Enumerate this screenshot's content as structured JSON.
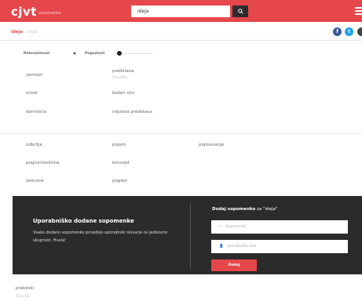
{
  "header": {
    "logo": "cjvt",
    "logo_sub": "sopomenke",
    "search_value": "ideja"
  },
  "subbar": {
    "word": "ideja",
    "extra": "[ideja]"
  },
  "controls": {
    "sort_label": "Relevantnost",
    "mode_label": "Pogostost",
    "slider_level": 0.1
  },
  "groups": [
    {
      "rows": [
        [
          {
            "text": "zamisel"
          },
          {
            "text": "predstava",
            "sub": "Prevedba"
          }
        ],
        [
          {
            "text": "misel"
          },
          {
            "text": "bežen vtis"
          }
        ],
        [
          {
            "text": "domislica"
          },
          {
            "text": "nejasna predstava"
          }
        ]
      ]
    },
    {
      "rows": [
        [
          {
            "text": "odkritje"
          },
          {
            "text": "pojem"
          },
          {
            "text": "pojmovanje"
          }
        ],
        [
          {
            "text": "pogruntavščina"
          },
          {
            "text": "koncept"
          }
        ],
        [
          {
            "text": "zasnova"
          },
          {
            "text": "pogled"
          }
        ]
      ]
    }
  ],
  "panel": {
    "title": "Uporabniško dodane sopomenke",
    "text": "Vsako dodano sopomenko povežejo uporabniki slovarja za jezikovno skupnost. Hvala!",
    "form_title_bold": "Dodaj sopomenko",
    "form_title_rest": " za \"ideja\"",
    "input1_placeholder": "Sopomenka",
    "input2_placeholder": "Uporabniško ime",
    "submit_label": "Dodaj"
  },
  "bottom": {
    "word": "prebliski",
    "sub": "Tanja KR"
  },
  "colors": {
    "accent": "#e5474a",
    "dark": "#2b2b2b",
    "facebook": "#3b5998",
    "twitter": "#1da1f2"
  }
}
